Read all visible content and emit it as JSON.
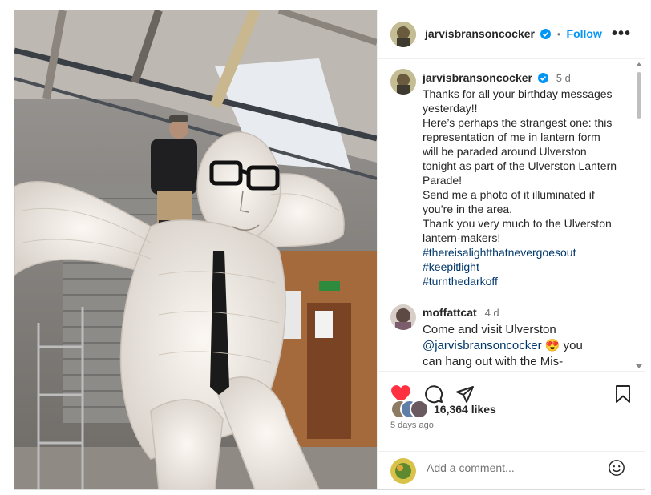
{
  "post": {
    "username": "jarvisbransoncocker",
    "follow_label": "Follow",
    "separator": "•",
    "more_label": "•••"
  },
  "caption": {
    "username": "jarvisbransoncocker",
    "time": "5 d",
    "lines": [
      "Thanks for all your birthday messages",
      "yesterday!!",
      "Here’s perhaps the strangest one: this",
      "representation of me in lantern form",
      "will be paraded around Ulverston",
      "tonight as part of the Ulverston Lantern",
      "Parade!",
      "Send me a photo of it illuminated if",
      "you’re in the area.",
      "Thank you very much to the Ulverston",
      "lantern-makers!"
    ],
    "hashtags": [
      "#thereisalightthatnevergoesout",
      "#keepitlight",
      "#turnthedarkoff"
    ]
  },
  "comment": {
    "username": "moffattcat",
    "time": "4 d",
    "line1": "Come and visit Ulverston",
    "mention": "@jarvisbransoncocker",
    "emoji": "😍",
    "line2_tail": " you",
    "line3": "can hang out with the Mis-"
  },
  "actions": {
    "icons": [
      "heart-icon",
      "comment-icon",
      "share-icon",
      "bookmark-icon"
    ],
    "liked_color": "#ff3040"
  },
  "likes": {
    "count_text": "16,364 likes",
    "ago": "5 days ago"
  },
  "add_comment": {
    "placeholder": "Add a comment..."
  },
  "colors": {
    "accent": "#0095f6",
    "link": "#00376b",
    "verified": "#0095f6"
  }
}
